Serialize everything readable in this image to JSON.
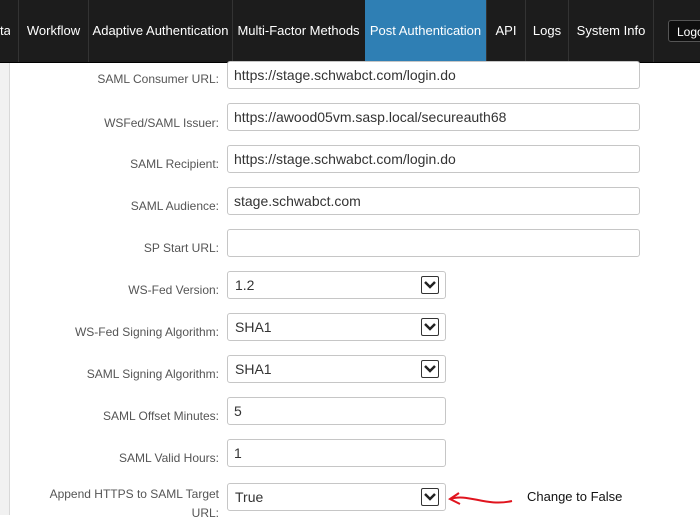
{
  "nav": {
    "items": [
      {
        "label": "ta"
      },
      {
        "label": "Workflow"
      },
      {
        "label": "Adaptive Authentication"
      },
      {
        "label": "Multi-Factor Methods"
      },
      {
        "label": "Post Authentication"
      },
      {
        "label": "API"
      },
      {
        "label": "Logs"
      },
      {
        "label": "System Info"
      }
    ],
    "active": "Post Authentication",
    "logout_label": "Logout",
    "colors": {
      "bar": "#1c1c1c",
      "active": "#2f7fb4"
    }
  },
  "form": {
    "saml_consumer_url": {
      "label": "SAML Consumer URL:",
      "value": "https://stage.schwabct.com/login.do"
    },
    "wsfed_saml_issuer": {
      "label": "WSFed/SAML Issuer:",
      "value": "https://awood05vm.sasp.local/secureauth68"
    },
    "saml_recipient": {
      "label": "SAML Recipient:",
      "value": "https://stage.schwabct.com/login.do"
    },
    "saml_audience": {
      "label": "SAML Audience:",
      "value": "stage.schwabct.com"
    },
    "sp_start_url": {
      "label": "SP Start URL:",
      "value": ""
    },
    "ws_fed_version": {
      "label": "WS-Fed Version:",
      "value": "1.2"
    },
    "ws_fed_signing_algorithm": {
      "label": "WS-Fed Signing Algorithm:",
      "value": "SHA1"
    },
    "saml_signing_algorithm": {
      "label": "SAML Signing Algorithm:",
      "value": "SHA1"
    },
    "saml_offset_minutes": {
      "label": "SAML Offset Minutes:",
      "value": "5"
    },
    "saml_valid_hours": {
      "label": "SAML Valid Hours:",
      "value": "1"
    },
    "append_https": {
      "label": "Append HTTPS to SAML Target URL:",
      "value": "True"
    }
  },
  "annotation": {
    "text": "Change to False",
    "color": "#e0141e"
  }
}
